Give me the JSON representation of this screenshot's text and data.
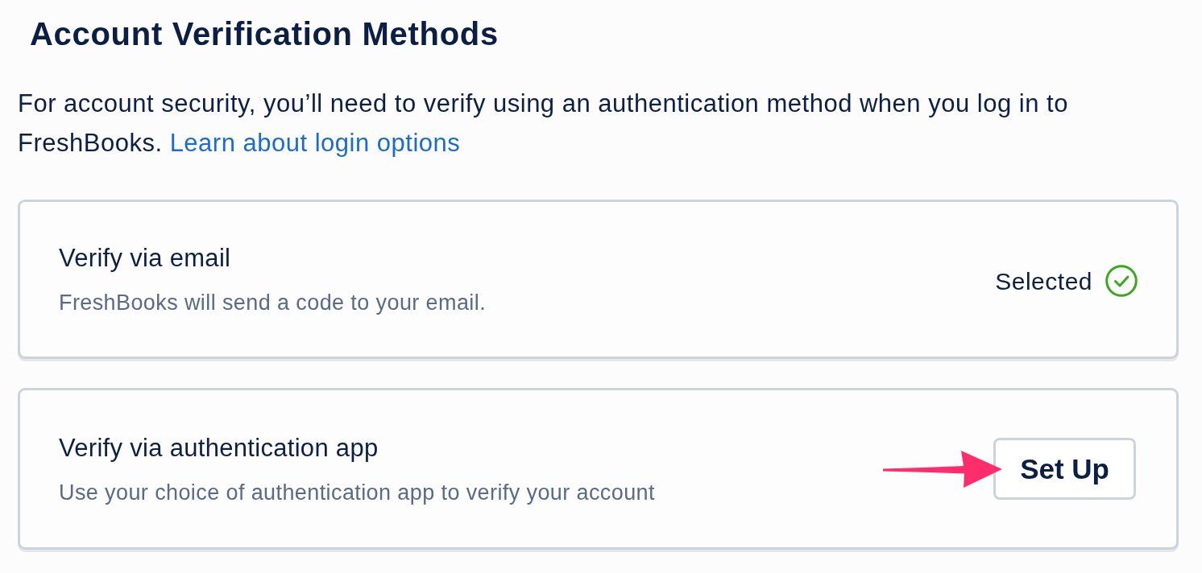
{
  "title": "Account Verification Methods",
  "intro": {
    "text": "For account security, you’ll need to verify using an authentication method when you log in to FreshBooks.",
    "link": "Learn about login options"
  },
  "methods": [
    {
      "title": "Verify via email",
      "description": "FreshBooks will send a code to your email.",
      "selected": true,
      "status": "Selected",
      "annotated": false
    },
    {
      "title": "Verify via authentication app",
      "description": "Use your choice of authentication app to verify your account",
      "selected": false,
      "action": "Set Up",
      "annotated": true
    }
  ]
}
